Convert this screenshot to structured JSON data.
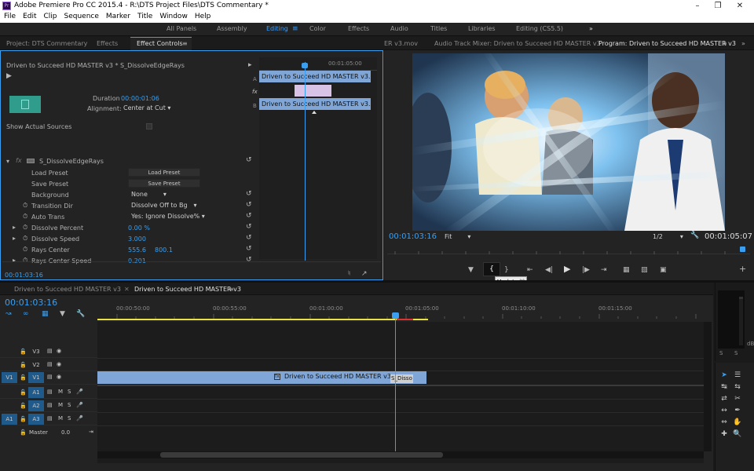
{
  "window": {
    "title": "Adobe Premiere Pro CC 2015.4 - R:\\DTS Project Files\\DTS Commentary *",
    "app_icon": "Pr"
  },
  "menu": [
    "File",
    "Edit",
    "Clip",
    "Sequence",
    "Marker",
    "Title",
    "Window",
    "Help"
  ],
  "workspaces": {
    "items": [
      "All Panels",
      "Assembly",
      "Editing",
      "Color",
      "Effects",
      "Audio",
      "Titles",
      "Libraries",
      "Editing (CS5.5)"
    ],
    "active": "Editing",
    "more": "»"
  },
  "left_tabs": {
    "project": "Project: DTS Commentary",
    "effects": "Effects",
    "effect_controls": "Effect Controls"
  },
  "ec": {
    "header": "Driven to Succeed HD MASTER v3 * S_DissolveEdgeRays",
    "timecode_ruler": "00:01:05:00",
    "clip_a": "Driven to Succeed HD MASTER v3.mov",
    "clip_b": "Driven to Succeed HD MASTER v3.mov",
    "track_a": "A",
    "track_b": "B",
    "fx": "fx",
    "duration_label": "Duration",
    "duration_value": "00:00:01:06",
    "alignment_label": "Alignment:",
    "alignment_value": "Center at Cut",
    "show_sources": "Show Actual Sources",
    "effect_name": "S_DissolveEdgeRays",
    "params": [
      {
        "name": "Load Preset",
        "value": "Load Preset",
        "type": "button"
      },
      {
        "name": "Save Preset",
        "value": "Save Preset",
        "type": "button"
      },
      {
        "name": "Background",
        "value": "None",
        "type": "dropdown"
      },
      {
        "name": "Transition Dir",
        "value": "Dissolve Off to Bg",
        "type": "dropdown"
      },
      {
        "name": "Auto Trans",
        "value": "Yes: Ignore Dissolve%",
        "type": "dropdown"
      },
      {
        "name": "Dissolve Percent",
        "value": "0.00 %",
        "type": "blue"
      },
      {
        "name": "Dissolve Speed",
        "value": "3.000",
        "type": "blue"
      },
      {
        "name": "Rays Center",
        "value": "555.6",
        "value2": "800.1",
        "type": "blue"
      },
      {
        "name": "Rays Center Speed",
        "value": "0.201",
        "type": "blue"
      }
    ],
    "current_time": "00:01:03:16"
  },
  "program": {
    "tabs": [
      "ER v3.mov",
      "Audio Track Mixer: Driven to Succeed HD MASTER v3",
      "Program: Driven to Succeed HD MASTER v3"
    ],
    "playhead_time": "00:01:03:16",
    "fit": "Fit",
    "resolution": "1/2",
    "duration": "00:01:05:07",
    "tooltip": "Mark In (I)"
  },
  "timeline": {
    "tabs": [
      "Driven to Succeed HD MASTER v3",
      "Driven to Succeed HD MASTER v3"
    ],
    "current_time": "00:01:03:16",
    "ruler": [
      "00:00:50:00",
      "00:00:55:00",
      "00:01:00:00",
      "00:01:05:00",
      "00:01:10:00",
      "00:01:15:00"
    ],
    "tracks": [
      {
        "src": "",
        "name": "V3"
      },
      {
        "src": "",
        "name": "V2"
      },
      {
        "src": "V1",
        "name": "V1"
      },
      {
        "src": "",
        "name": "A1"
      },
      {
        "src": "",
        "name": "A2"
      },
      {
        "src": "A1",
        "name": "A3"
      }
    ],
    "master_label": "Master",
    "master_value": "0.0",
    "clip_label": "Driven to Succeed HD MASTER v3.mov",
    "transition_label": "S_Disso",
    "meter_labels": [
      "S",
      "S"
    ]
  },
  "colors": {
    "accent": "#3a9ff0",
    "clip": "#7fa6d6",
    "panel": "#232323"
  }
}
